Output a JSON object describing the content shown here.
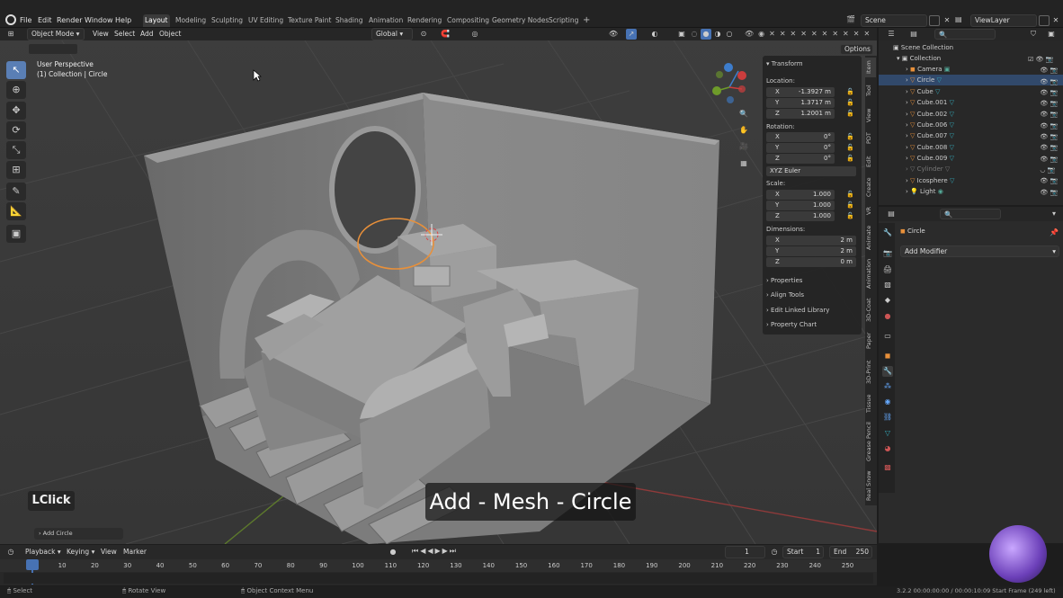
{
  "topbar": {
    "menus": [
      "File",
      "Edit",
      "Render",
      "Window",
      "Help"
    ],
    "workspaces": [
      "Layout",
      "Modeling",
      "Sculpting",
      "UV Editing",
      "Texture Paint",
      "Shading",
      "Animation",
      "Rendering",
      "Compositing",
      "Geometry Nodes",
      "Scripting"
    ],
    "scene": "Scene",
    "view_layer": "ViewLayer"
  },
  "viewport": {
    "mode": "Object Mode",
    "menus": [
      "View",
      "Select",
      "Add",
      "Object"
    ],
    "orientation": "Global",
    "options_label": "Options",
    "perspective": "User Perspective",
    "context": "(1) Collection | Circle",
    "caption": "Add - Mesh - Circle",
    "key_hint": "LClick",
    "operator_panel": "Add Circle"
  },
  "npanel": {
    "transform_title": "Transform",
    "location_label": "Location:",
    "location": {
      "x": "-1.3927 m",
      "y": "1.3717 m",
      "z": "1.2001 m"
    },
    "rotation_label": "Rotation:",
    "rotation": {
      "x": "0°",
      "y": "0°",
      "z": "0°"
    },
    "rotation_mode": "XYZ Euler",
    "scale_label": "Scale:",
    "scale": {
      "x": "1.000",
      "y": "1.000",
      "z": "1.000"
    },
    "dimensions_label": "Dimensions:",
    "dimensions": {
      "x": "2 m",
      "y": "2 m",
      "z": "0 m"
    },
    "axes": [
      "X",
      "Y",
      "Z"
    ],
    "sections": [
      "Properties",
      "Align Tools",
      "Edit Linked Library",
      "Property Chart"
    ],
    "tabs": [
      "Item",
      "Tool",
      "View",
      "PDT",
      "Edit",
      "Create",
      "VR",
      "Animate",
      "Animation",
      "3D-Coat",
      "Paper",
      "3D-Print",
      "Tissue",
      "Grease Pencil",
      "Real Snow"
    ]
  },
  "outliner": {
    "root": "Scene Collection",
    "collection": "Collection",
    "items": [
      "Camera",
      "Circle",
      "Cube",
      "Cube.001",
      "Cube.002",
      "Cube.006",
      "Cube.007",
      "Cube.008",
      "Cube.009",
      "Cylinder",
      "Icosphere",
      "Light"
    ],
    "selected": "Circle"
  },
  "properties": {
    "object_name": "Circle",
    "add_modifier": "Add Modifier"
  },
  "timeline": {
    "menus": [
      "Playback",
      "Keying",
      "View",
      "Marker"
    ],
    "current_frame": "1",
    "start_label": "Start",
    "start": "1",
    "end_label": "End",
    "end": "250",
    "ticks": [
      "1",
      "10",
      "20",
      "30",
      "40",
      "50",
      "60",
      "70",
      "80",
      "90",
      "100",
      "110",
      "120",
      "130",
      "140",
      "150",
      "160",
      "170",
      "180",
      "190",
      "200",
      "210",
      "220",
      "230",
      "240",
      "250"
    ]
  },
  "statusbar": {
    "select": "Select",
    "rotate": "Rotate View",
    "context_menu": "Object Context Menu",
    "info": "3.2.2   00:00:00:00 / 00:00:10:09   Start Frame (249 left)"
  },
  "colors": {
    "accent": "#4772b3",
    "selection_outline": "#e8903a",
    "axis_red": "#cc3d3d",
    "axis_green": "#6e9b2a",
    "axis_blue": "#3d7dcc"
  }
}
